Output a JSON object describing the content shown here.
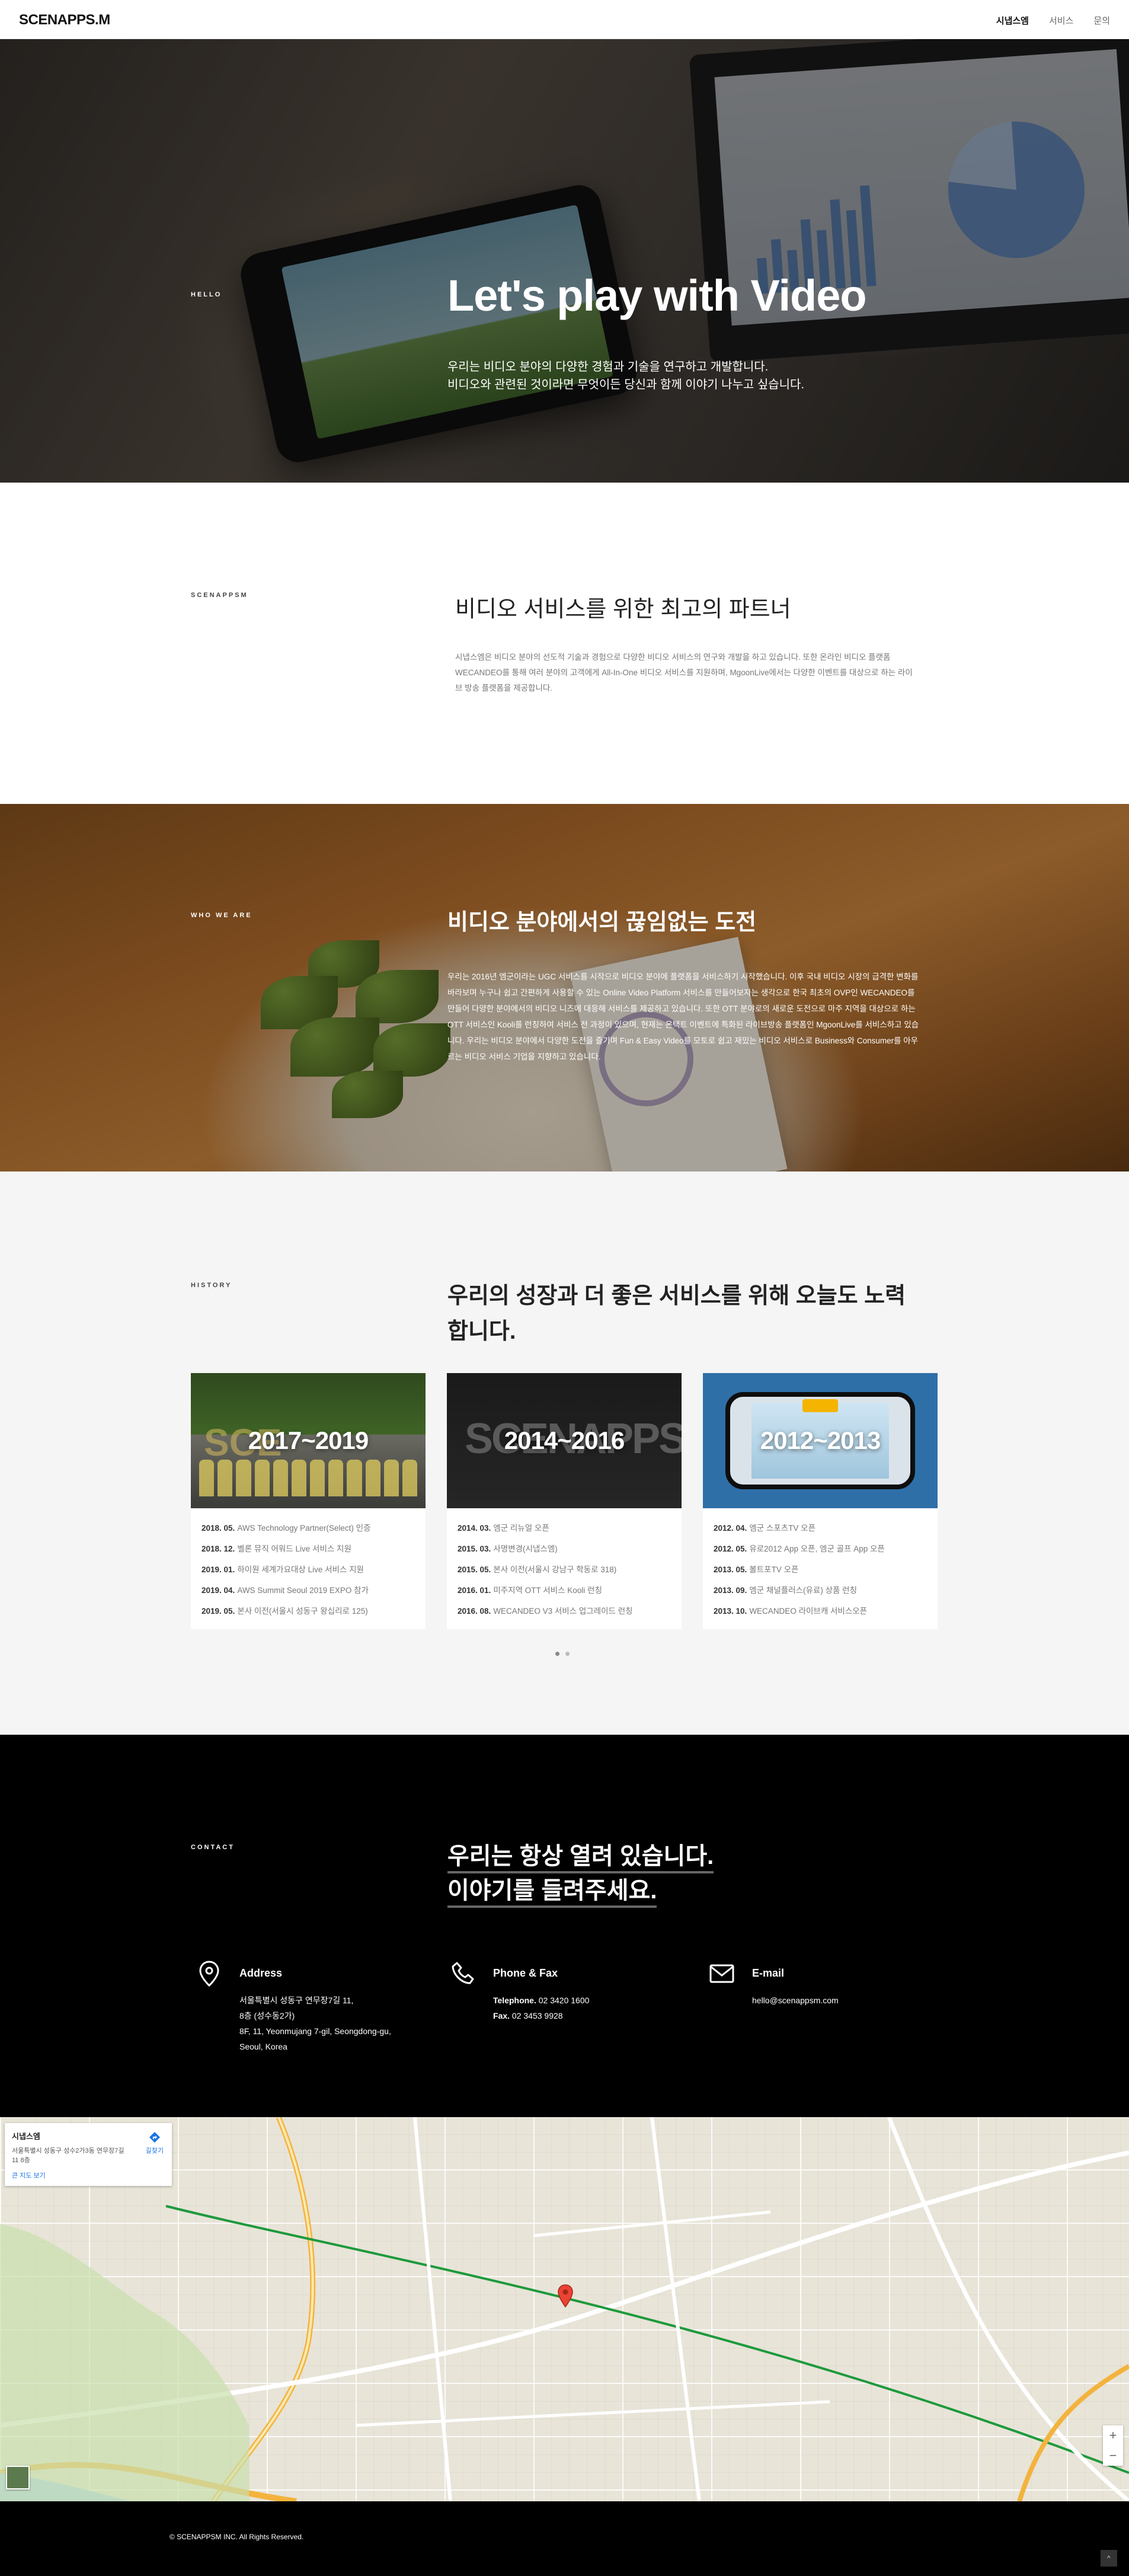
{
  "header": {
    "logo": "SCENAPPS.M",
    "nav": [
      "시냅스엠",
      "서비스",
      "문의"
    ]
  },
  "hero": {
    "label": "HELLO",
    "title": "Let's play with Video",
    "line1": "우리는 비디오 분야의 다양한 경험과 기술을 연구하고 개발합니다.",
    "line2": "비디오와 관련된 것이라면 무엇이든 당신과 함께 이야기 나누고 싶습니다."
  },
  "partner": {
    "label": "SCENAPPSM",
    "title": "비디오 서비스를 위한 최고의 파트너",
    "body": "시냅스엠은 비디오 분야의 선도적 기술과 경험으로 다양한 비디오 서비스의 연구와 개발을 하고 있습니다. 또한 온라인 비디오 플랫폼 WECANDEO를 통해 여러 분야의 고객에게 All-In-One 비디오 서비스를 지원하며, MgoonLive에서는 다양한 이벤트를 대상으로 하는 라이브 방송 플랫폼을 제공합니다."
  },
  "challenge": {
    "label": "WHO WE ARE",
    "title": "비디오 분야에서의 끊임없는 도전",
    "body": "우리는 2016년 엠군이라는 UGC 서비스를 시작으로 비디오 분야에 플랫폼을 서비스하기 시작했습니다. 이후 국내 비디오 시장의 급격한 변화를 바라보며 누구나 쉽고 간편하게 사용할 수 있는 Online Video Platform 서비스를 만들어보자는 생각으로 한국 최초의 OVP인 WECANDEO를 만들어 다양한 분야에서의 비디오 니즈에 대응해 서비스를 제공하고 있습니다. 또한 OTT 분야로의 새로운 도전으로 마주 지역을 대상으로 하는 OTT 서비스인 Kooli를 런칭하여 서비스 전 과정이 있으며, 현재는 온택트 이벤트에 특화된 라이브방송 플랫폼인 MgoonLive를 서비스하고 있습니다. 우리는 비디오 분야에서 다양한 도전을 즐기며 Fun & Easy Video를 모토로 쉽고 재밌는 비디오 서비스로 Business와 Consumer를 아우르는 비디오 서비스 기업을 지향하고 있습니다."
  },
  "history": {
    "label": "HISTORY",
    "title": "우리의 성장과 더 좋은 서비스를 위해 오늘도 노력합니다.",
    "cards": [
      {
        "period": "2017~2019",
        "image_icon": "team-photo",
        "items": [
          {
            "date": "2018. 05.",
            "text": "AWS Technology Partner(Select) 인증"
          },
          {
            "date": "2018. 12.",
            "text": "벨론 뮤직 어워드 Live 서비스 지원"
          },
          {
            "date": "2019. 01.",
            "text": "하이원 세계가요대상 Live 서비스 지원"
          },
          {
            "date": "2019. 04.",
            "text": "AWS Summit Seoul 2019 EXPO 참가"
          },
          {
            "date": "2019. 05.",
            "text": "본사 이전(서울시 성동구 왕십리로 125)"
          }
        ]
      },
      {
        "period": "2014~2016",
        "image_icon": "office-wall-logo",
        "items": [
          {
            "date": "2014. 03.",
            "text": "엠군 리뉴얼 오픈"
          },
          {
            "date": "2015. 03.",
            "text": "사명변경(시냅스엠)"
          },
          {
            "date": "2015. 05.",
            "text": "본사 이전(서울시 강남구 학동로 318)"
          },
          {
            "date": "2016. 01.",
            "text": "미주지역 OTT 서비스 Kooli 런칭"
          },
          {
            "date": "2016. 08.",
            "text": "WECANDEO V3 서비스 업그레이드 런칭"
          }
        ]
      },
      {
        "period": "2012~2013",
        "image_icon": "mobile-app-phone",
        "items": [
          {
            "date": "2012. 04.",
            "text": "엠군 스포츠TV 오픈"
          },
          {
            "date": "2012. 05.",
            "text": "유로2012 App 오픈, 엠군 골프 App 오픈"
          },
          {
            "date": "2013. 05.",
            "text": "볼트포TV 오픈"
          },
          {
            "date": "2013. 09.",
            "text": "엠군 채널플러스(유료) 상품 런칭"
          },
          {
            "date": "2013. 10.",
            "text": "WECANDEO 라이브캐 서비스오픈"
          }
        ]
      }
    ],
    "pager": {
      "total": 2,
      "active": 1
    }
  },
  "contact": {
    "label": "CONTACT",
    "title_line1": "우리는 항상 열려 있습니다.",
    "title_line2": "이야기를 들려주세요.",
    "address": {
      "icon": "location-pin-icon",
      "heading": "Address",
      "line1": "서울특별시 성동구 연무장7길 11,",
      "line2": "8층 (성수동2가)",
      "line3": "8F, 11, Yeonmujang 7-gil, Seongdong-gu,",
      "line4": "Seoul, Korea"
    },
    "phone": {
      "icon": "phone-icon",
      "heading": "Phone & Fax",
      "tel_label": "Telephone.",
      "tel": "02 3420 1600",
      "fax_label": "Fax.",
      "fax": "02 3453 9928"
    },
    "email": {
      "icon": "envelope-icon",
      "heading": "E-mail",
      "value": "hello@scenappsm.com"
    }
  },
  "map": {
    "place_name": "시냅스엠",
    "place_address": "서울특별시 성동구 성수2가3동 연무장7길 11 8층",
    "directions_label": "길찾기",
    "larger_map_link": "큰 지도 보기",
    "zoom_in": "+",
    "zoom_out": "−"
  },
  "footer": {
    "copyright": "© SCENAPPSM INC. All Rights Reserved.",
    "top_button": "^"
  }
}
